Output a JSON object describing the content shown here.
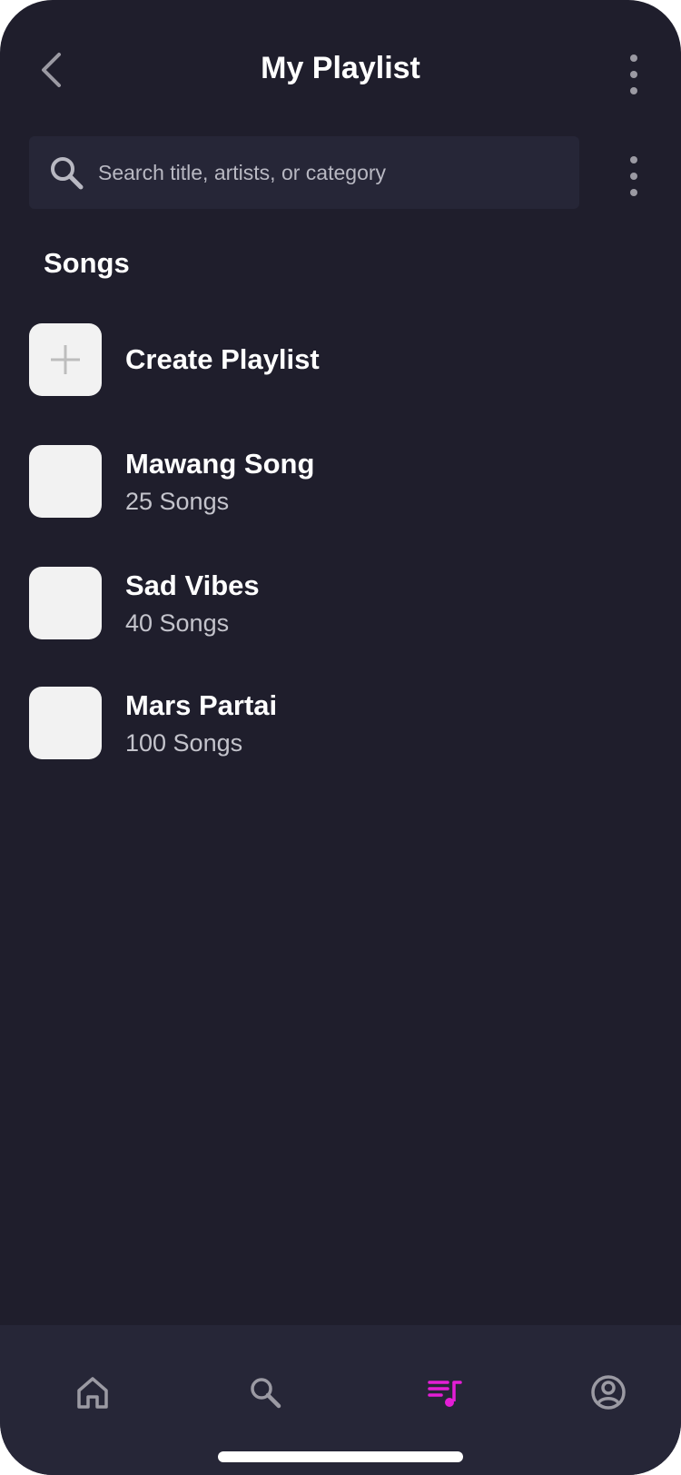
{
  "header": {
    "title": "My Playlist"
  },
  "search": {
    "placeholder": "Search title, artists, or category",
    "value": ""
  },
  "section": {
    "title": "Songs"
  },
  "create_playlist": {
    "label": "Create Playlist"
  },
  "playlists": [
    {
      "title": "Mawang Song",
      "count": "25 Songs"
    },
    {
      "title": "Sad Vibes",
      "count": "40 Songs"
    },
    {
      "title": "Mars Partai",
      "count": "100 Songs"
    }
  ],
  "nav": {
    "items": [
      "home-icon",
      "search-icon",
      "playlist-icon",
      "profile-icon"
    ],
    "active": "playlist-icon"
  },
  "colors": {
    "background": "#1f1e2c",
    "surface": "#262637",
    "accent": "#e41ed6",
    "icon_muted": "#9b9aa3",
    "text_primary": "#ffffff",
    "text_secondary": "#c4c4cc"
  }
}
